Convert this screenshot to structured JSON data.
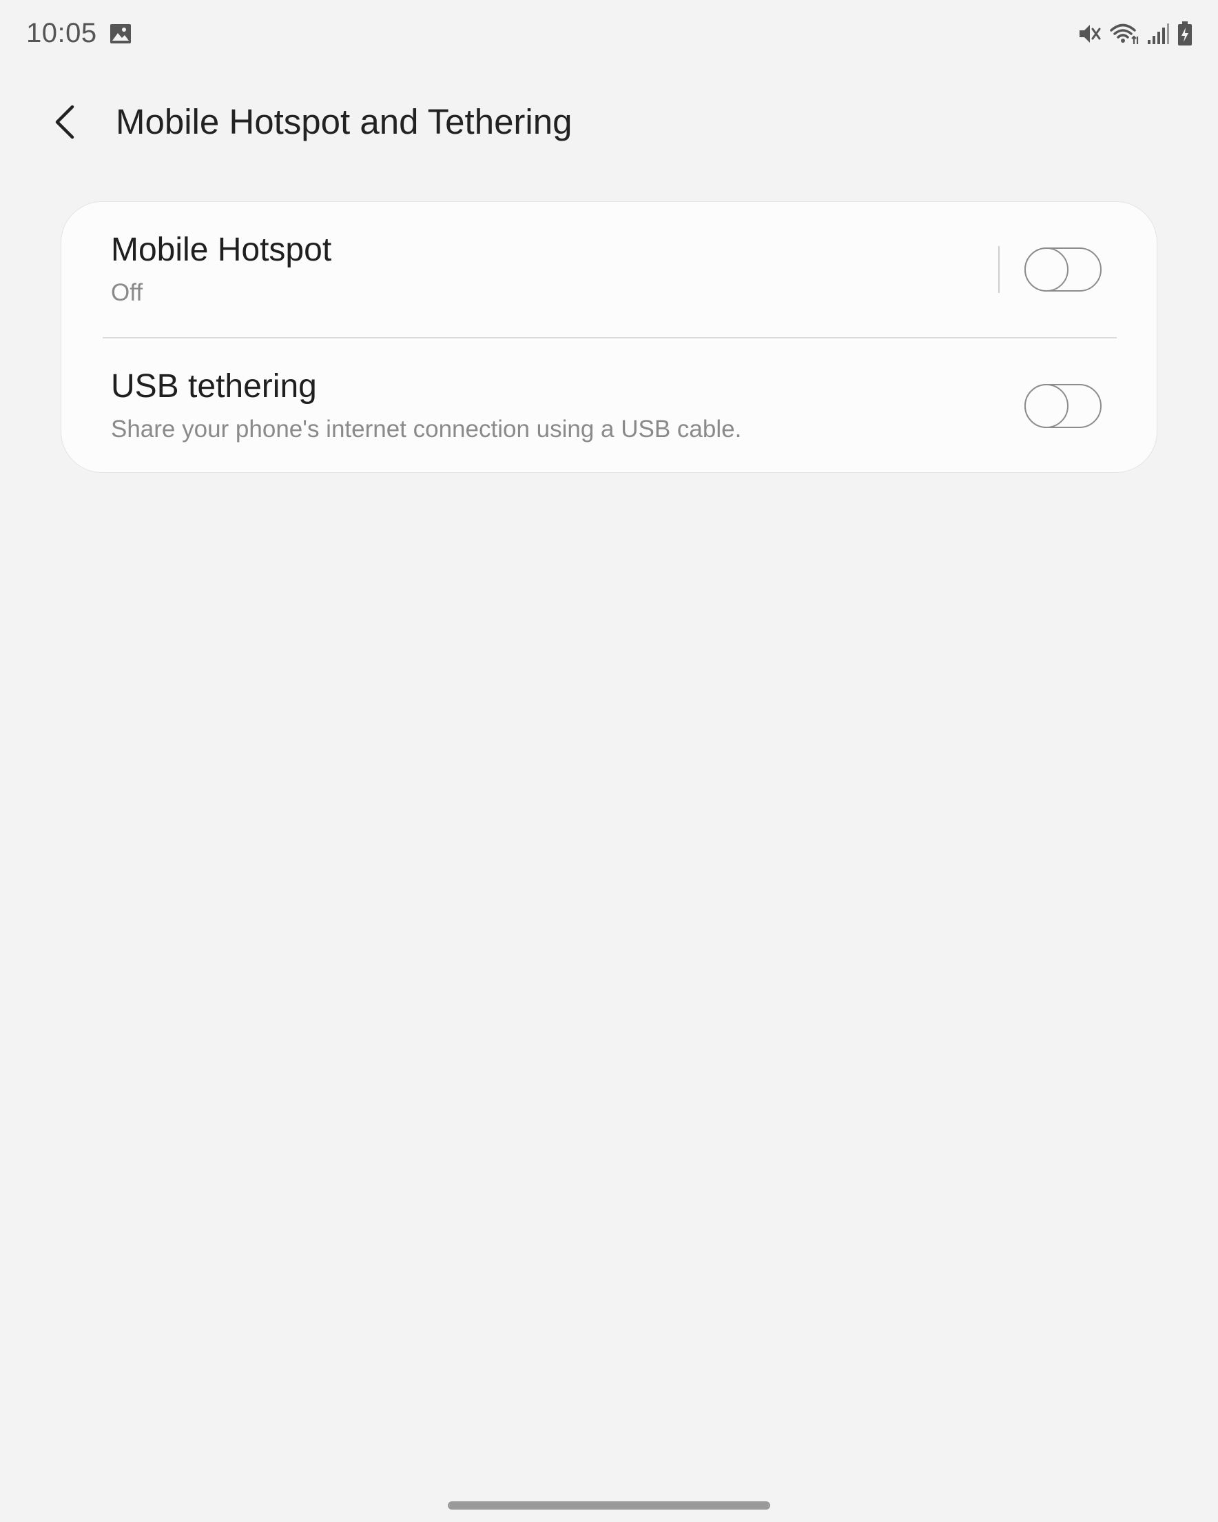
{
  "status_bar": {
    "time": "10:05",
    "left_icons": [
      "gallery-icon"
    ],
    "right_icons": [
      "mute-icon",
      "wifi-icon",
      "signal-icon",
      "battery-charging-icon"
    ]
  },
  "header": {
    "back_icon": "chevron-left-icon",
    "title": "Mobile Hotspot and Tethering"
  },
  "settings": {
    "mobile_hotspot": {
      "title": "Mobile Hotspot",
      "subtitle": "Off",
      "enabled": false
    },
    "usb_tethering": {
      "title": "USB tethering",
      "subtitle": "Share your phone's internet connection using a USB cable.",
      "enabled": false
    }
  },
  "colors": {
    "background": "#f3f3f3",
    "card": "#fcfcfc",
    "primary_text": "#1f1f1f",
    "secondary_text": "#8a8a8a",
    "switch_off": "#8c8c8c"
  }
}
